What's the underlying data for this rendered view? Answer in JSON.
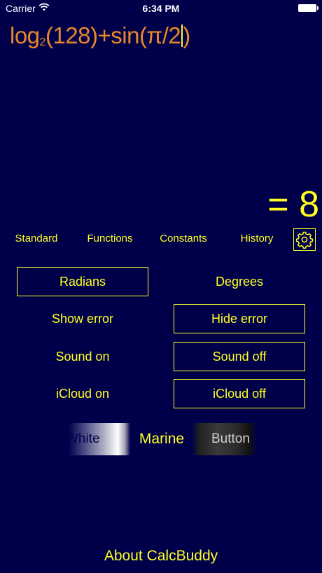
{
  "status_bar": {
    "carrier": "Carrier",
    "time": "6:34 PM"
  },
  "display": {
    "expression_prefix": "log",
    "expression_subscript": "2",
    "expression_rest": "(128)+sin(π/2",
    "expression_close": ")",
    "result": "= 8"
  },
  "tabs": {
    "standard": "Standard",
    "functions": "Functions",
    "constants": "Constants",
    "history": "History",
    "settings_icon": "gear-icon"
  },
  "settings": {
    "radians": "Radians",
    "degrees": "Degrees",
    "show_error": "Show error",
    "hide_error": "Hide error",
    "sound_on": "Sound on",
    "sound_off": "Sound off",
    "icloud_on": "iCloud on",
    "icloud_off": "iCloud off",
    "selected": [
      "Radians",
      "Hide error",
      "Sound off",
      "iCloud off"
    ]
  },
  "themes": {
    "white": "White",
    "marine": "Marine",
    "button": "Button",
    "selected": "Marine"
  },
  "footer": {
    "about": "About CalcBuddy"
  },
  "colors": {
    "background": "#00004a",
    "accent": "#ffff22",
    "expression": "#e8882a"
  }
}
